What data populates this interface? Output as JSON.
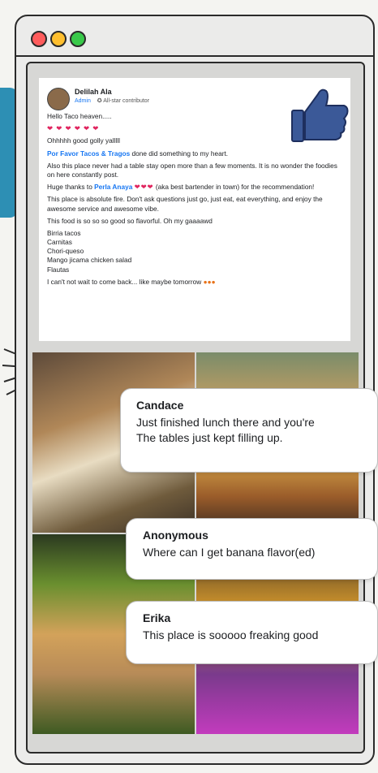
{
  "window": {
    "controls": [
      "close",
      "minimize",
      "maximize"
    ],
    "colors": {
      "close": "#ff5c5c",
      "minimize": "#ffbf2f",
      "maximize": "#39c94a"
    }
  },
  "post": {
    "author": "Delilah Ala",
    "role": "Admin",
    "badge": "All-star contributor",
    "line1": "Hello Taco heaven.....",
    "line2": "Ohhhhh good golly yalllll",
    "place_link": "Por Favor Tacos & Tragos",
    "line3_rest": "done did something to my heart.",
    "line4": "Also this place never had a table stay open more than a few moments. It is no wonder the foodies on here constantly post.",
    "thanks_prefix": "Huge thanks to",
    "person_link": "Perla Anaya",
    "thanks_suffix": "(aka best bartender in town) for the recommendation!",
    "line6": "This place is absolute fire. Don't ask questions just go, just eat, eat everything, and enjoy the awesome service and awesome vibe.",
    "line7": "This food is so so so good so flavorful. Oh my gaaaawd",
    "menu_items": [
      "Birria tacos",
      "Carnitas",
      "Chori-queso",
      "Mango jicama chicken salad",
      "Flautas"
    ],
    "closing": "I can't not wait to come back... like maybe tomorrow"
  },
  "comments": [
    {
      "name": "Candace",
      "text": "Just finished lunch there and you're\nThe tables just kept filling up."
    },
    {
      "name": "Anonymous",
      "text": "Where can I get banana flavor(ed)"
    },
    {
      "name": "Erika",
      "text": "This place is sooooo freaking good"
    }
  ],
  "icons": {
    "like": "thumbs-up-icon",
    "badge": "star-badge-icon"
  }
}
